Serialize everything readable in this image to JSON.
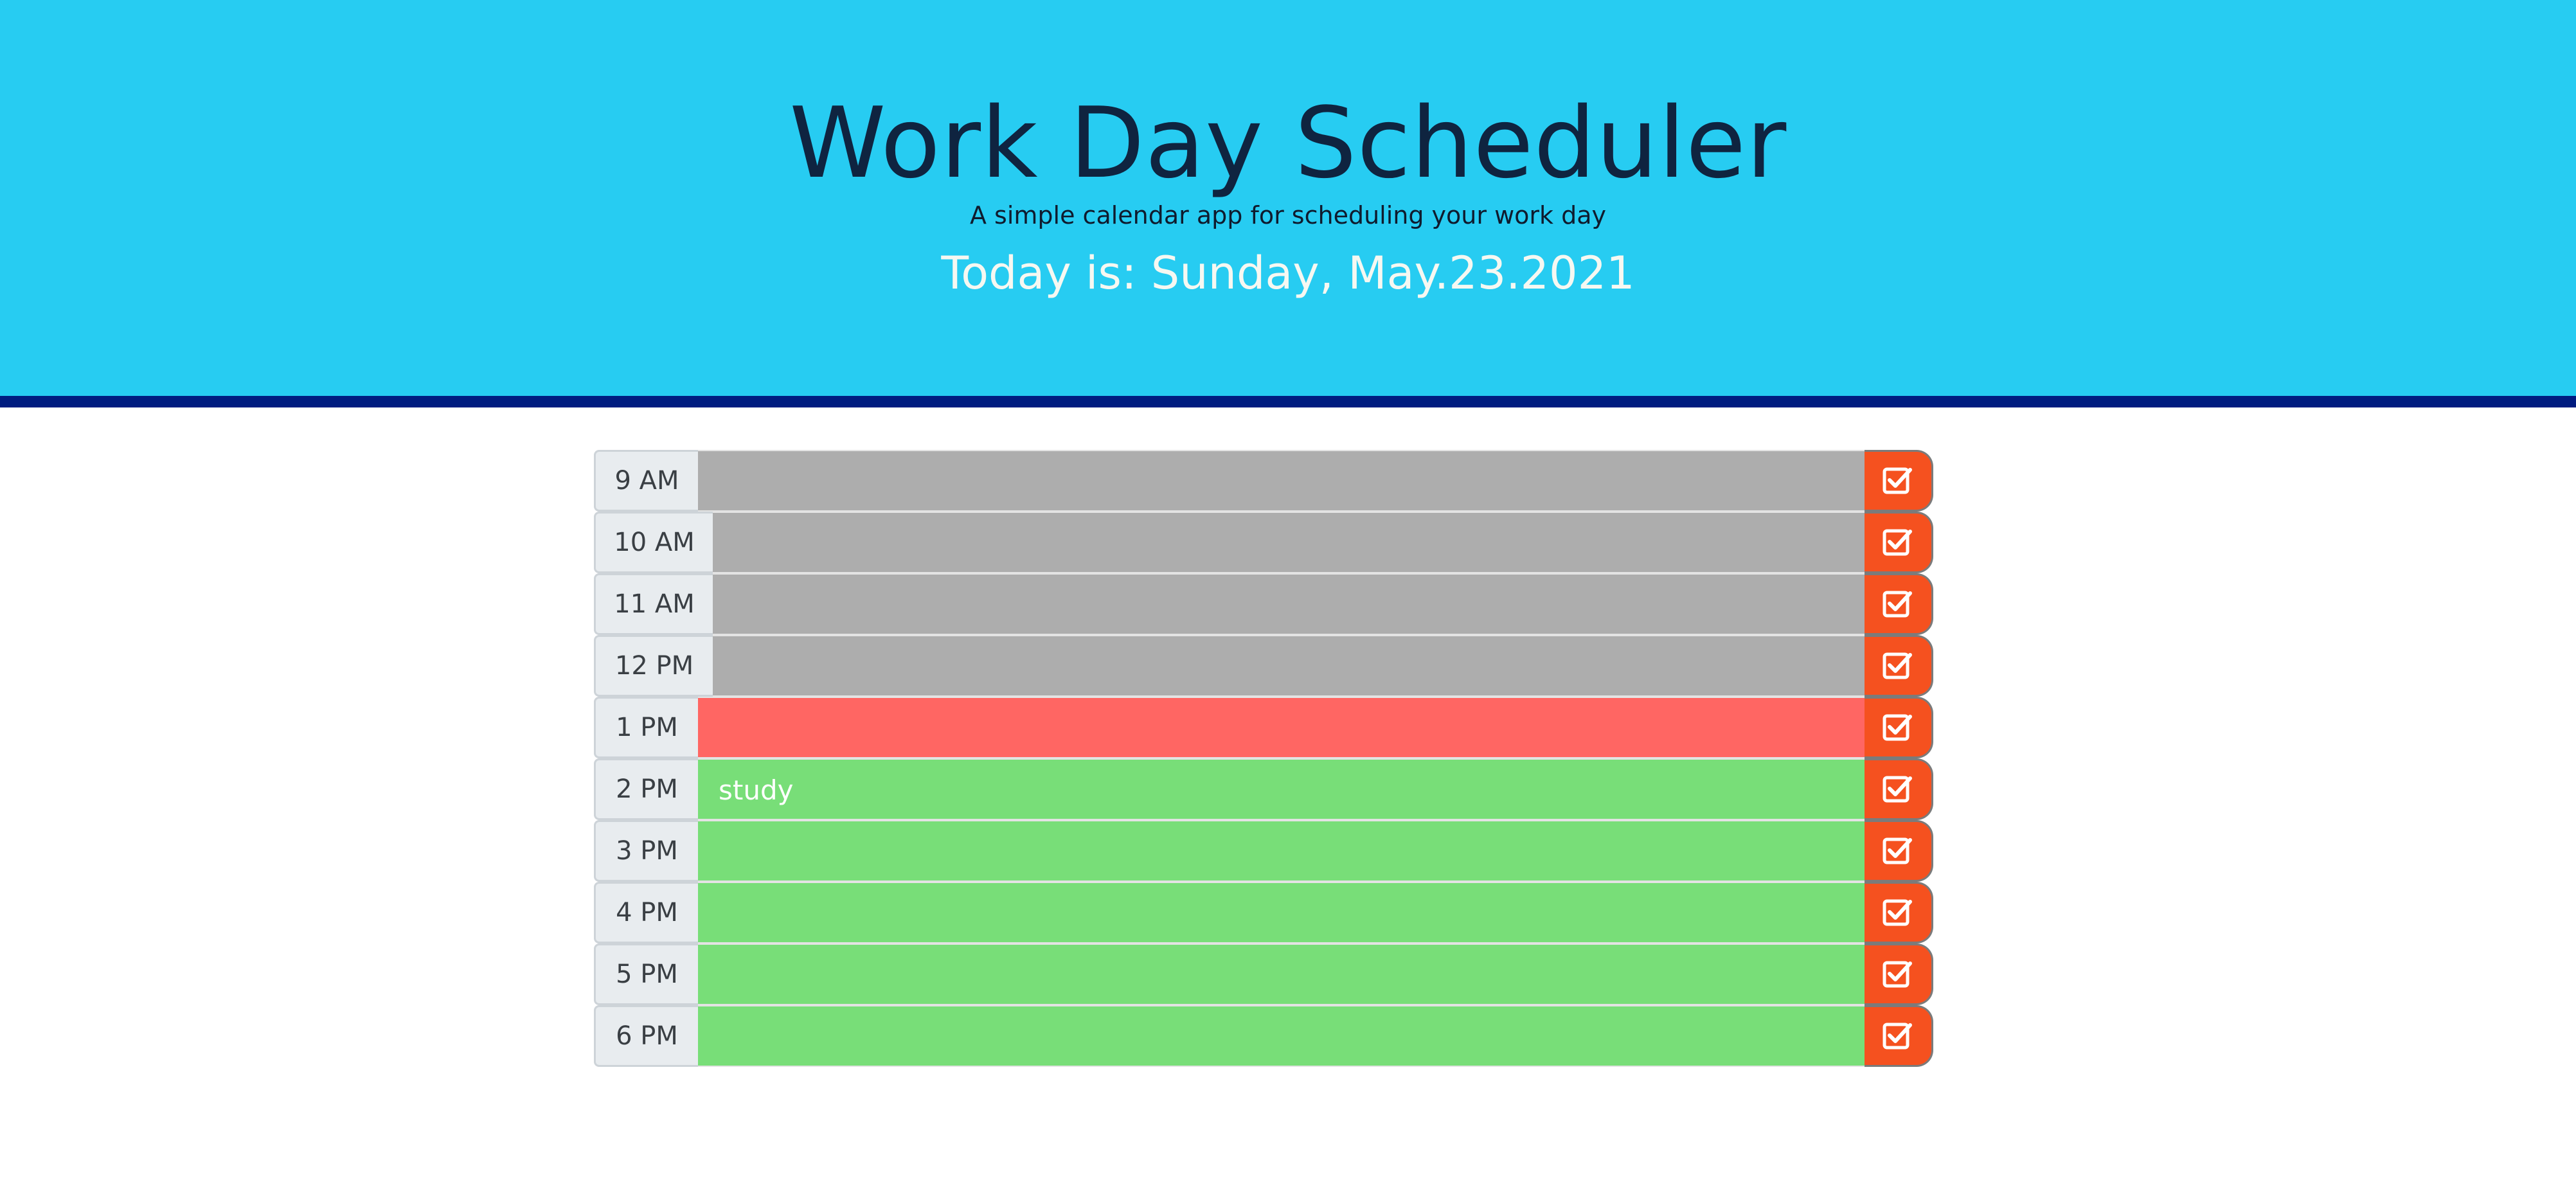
{
  "header": {
    "title": "Work Day Scheduler",
    "subtitle": "A simple calendar app for scheduling your work day",
    "date_line": "Today is: Sunday, May.23.2021"
  },
  "colors": {
    "header_bg": "#27ccf2",
    "header_border": "#001c80",
    "past": "#adadad",
    "present": "#ff6663",
    "future": "#78de78",
    "save_button": "#f5511f"
  },
  "rows": [
    {
      "hour": "9 AM",
      "text": "",
      "state": "past"
    },
    {
      "hour": "10 AM",
      "text": "",
      "state": "past"
    },
    {
      "hour": "11 AM",
      "text": "",
      "state": "past"
    },
    {
      "hour": "12 PM",
      "text": "",
      "state": "past"
    },
    {
      "hour": "1 PM",
      "text": "",
      "state": "present"
    },
    {
      "hour": "2 PM",
      "text": "study",
      "state": "future"
    },
    {
      "hour": "3 PM",
      "text": "",
      "state": "future"
    },
    {
      "hour": "4 PM",
      "text": "",
      "state": "future"
    },
    {
      "hour": "5 PM",
      "text": "",
      "state": "future"
    },
    {
      "hour": "6 PM",
      "text": "",
      "state": "future"
    }
  ],
  "save_icon": "check-square-icon"
}
